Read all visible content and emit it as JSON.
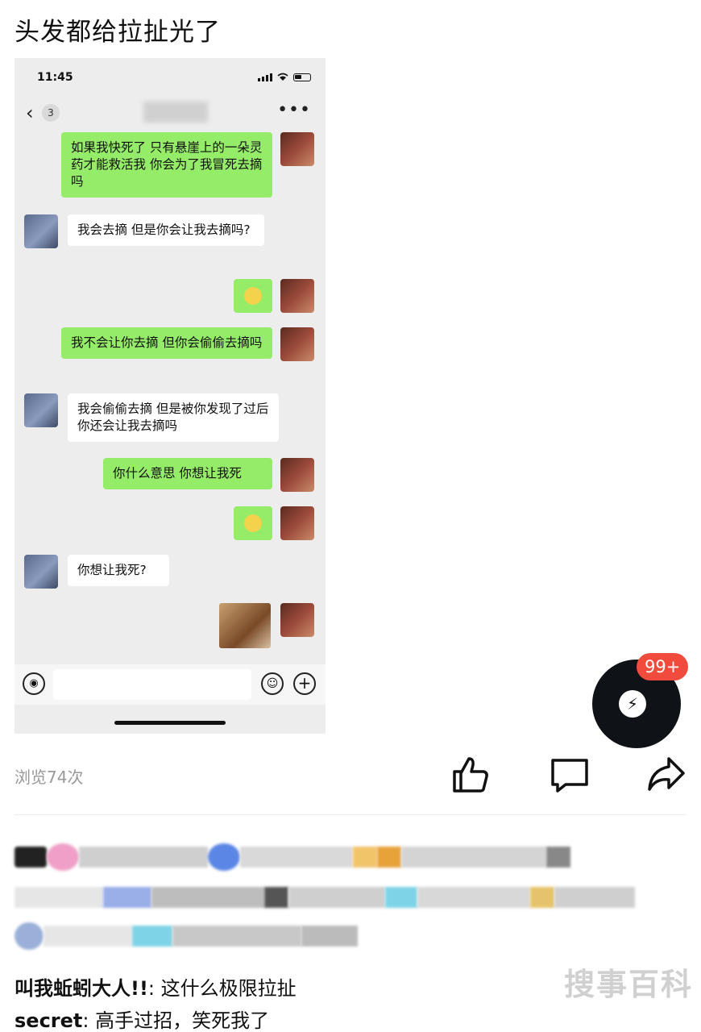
{
  "post": {
    "title": "头发都给拉扯光了",
    "views": "浏览74次"
  },
  "phone": {
    "time": "11:45",
    "unread_count": "3",
    "more": "•••",
    "messages": [
      {
        "side": "self",
        "text": "如果我快死了 只有悬崖上的一朵灵药才能救活我 你会为了我冒死去摘吗"
      },
      {
        "side": "other",
        "text": "我会去摘 但是你会让我去摘吗?"
      },
      {
        "side": "self",
        "type": "emoji",
        "icon": "grin-emoji"
      },
      {
        "side": "self",
        "text": "我不会让你去摘 但你会偷偷去摘吗"
      },
      {
        "side": "other",
        "text": "我会偷偷去摘 但是被你发现了过后你还会让我去摘吗"
      },
      {
        "side": "self",
        "text": "你什么意思 你想让我死"
      },
      {
        "side": "self",
        "type": "emoji",
        "icon": "grin-emoji"
      },
      {
        "side": "other",
        "text": "你想让我死?"
      },
      {
        "side": "self",
        "type": "sticker",
        "icon": "jerry-mouse-sticker"
      }
    ]
  },
  "floating": {
    "badge": "99+",
    "icon": "lightning-chat-icon"
  },
  "actions": {
    "like_icon": "thumbs-up-icon",
    "comment_icon": "comment-icon",
    "share_icon": "share-icon"
  },
  "comments": [
    {
      "author": "叫我蚯蚓大人!!",
      "text": ": 这什么极限拉扯"
    },
    {
      "author": "secret",
      "text": ": 高手过招，笑死我了"
    }
  ],
  "watermark": "搜事百科",
  "colors": {
    "green_bubble": "#95ec69",
    "badge_red": "#f04b3c",
    "float_bg": "#0f1317"
  }
}
